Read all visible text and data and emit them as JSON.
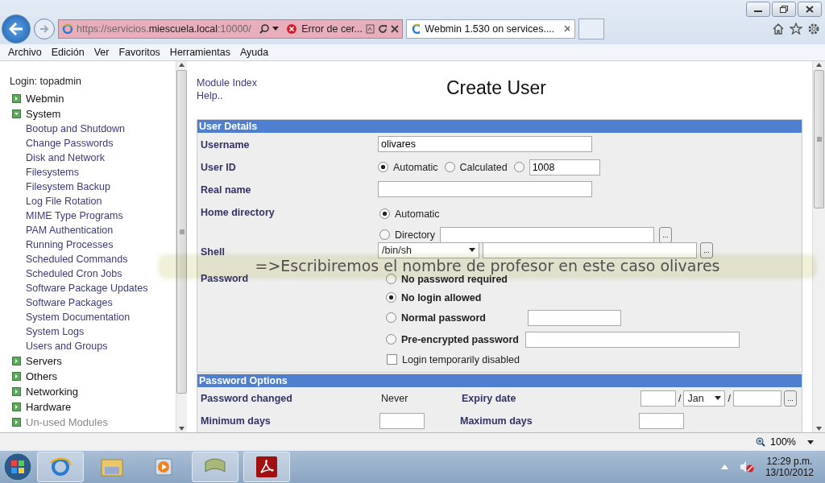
{
  "browser": {
    "address": {
      "prefix": "https://servicios.",
      "host": "miescuela.local",
      "suffix": ":10000/"
    },
    "error_tab": "Error de cer...",
    "tabs": [
      {
        "title": "Webmin 1.530 on services....",
        "selected": true
      }
    ],
    "menu": [
      "Archivo",
      "Edición",
      "Ver",
      "Favoritos",
      "Herramientas",
      "Ayuda"
    ],
    "zoom": "100%"
  },
  "sidebar": {
    "login": "Login: topadmin",
    "categories": [
      {
        "label": "Webmin",
        "expanded": false,
        "disabled": false
      },
      {
        "label": "System",
        "expanded": true,
        "disabled": false,
        "children": [
          "Bootup and Shutdown",
          "Change Passwords",
          "Disk and Network Filesystems",
          "Filesystem Backup",
          "Log File Rotation",
          "MIME Type Programs",
          "PAM Authentication",
          "Running Processes",
          "Scheduled Commands",
          "Scheduled Cron Jobs",
          "Software Package Updates",
          "Software Packages",
          "System Documentation",
          "System Logs",
          "Users and Groups"
        ]
      },
      {
        "label": "Servers",
        "expanded": false,
        "disabled": false
      },
      {
        "label": "Others",
        "expanded": false,
        "disabled": false
      },
      {
        "label": "Networking",
        "expanded": false,
        "disabled": false
      },
      {
        "label": "Hardware",
        "expanded": false,
        "disabled": false
      },
      {
        "label": "Un-used Modules",
        "expanded": false,
        "disabled": true
      }
    ]
  },
  "main": {
    "links": [
      "Module Index",
      "Help.."
    ],
    "title": "Create User",
    "user_details": {
      "title": "User Details",
      "rows": [
        {
          "kind": "text",
          "label": "Username",
          "value": "olivares"
        },
        {
          "kind": "radio-inline",
          "label": "User ID",
          "options": [
            {
              "kind": "plain",
              "label": "Automatic",
              "selected": true
            },
            {
              "kind": "plain",
              "label": "Calculated",
              "selected": false
            },
            {
              "kind": "field",
              "value": "1008",
              "selected": false
            }
          ]
        },
        {
          "kind": "text",
          "label": "Real name"
        },
        {
          "kind": "radio-stack",
          "label": "Home directory",
          "options": [
            {
              "kind": "plain",
              "label": "Automatic",
              "selected": true
            },
            {
              "kind": "browse",
              "label": "Directory",
              "selected": false,
              "button": "..."
            }
          ]
        },
        {
          "kind": "shell",
          "label": "Shell",
          "value": "/bin/sh",
          "button": "..."
        },
        {
          "kind": "password",
          "label": "Password",
          "options": [
            {
              "kind": "plain",
              "label": "No password required",
              "selected": false
            },
            {
              "kind": "plain",
              "label": "No login allowed",
              "selected": true
            },
            {
              "kind": "short-field",
              "label": "Normal password",
              "selected": false
            },
            {
              "kind": "long-field",
              "label": "Pre-encrypted password",
              "selected": false
            }
          ],
          "checkbox": {
            "label": "Login temporarily disabled",
            "checked": false
          }
        }
      ]
    },
    "password_options": {
      "title": "Password Options",
      "rows": [
        [
          {
            "kind": "value",
            "label": "Password changed",
            "value": "Never"
          },
          {
            "kind": "date",
            "label": "Expiry date",
            "month": "Jan",
            "separators": [
              "/",
              "/"
            ],
            "button": "..."
          }
        ],
        [
          {
            "kind": "field",
            "label": "Minimum days"
          },
          {
            "kind": "field",
            "label": "Maximum days"
          }
        ]
      ]
    }
  },
  "caption": "=>Escribiremos el nombre de profesor en este caso olivares",
  "taskbar": {
    "time": "12:29 p.m.",
    "date": "13/10/2012"
  }
}
